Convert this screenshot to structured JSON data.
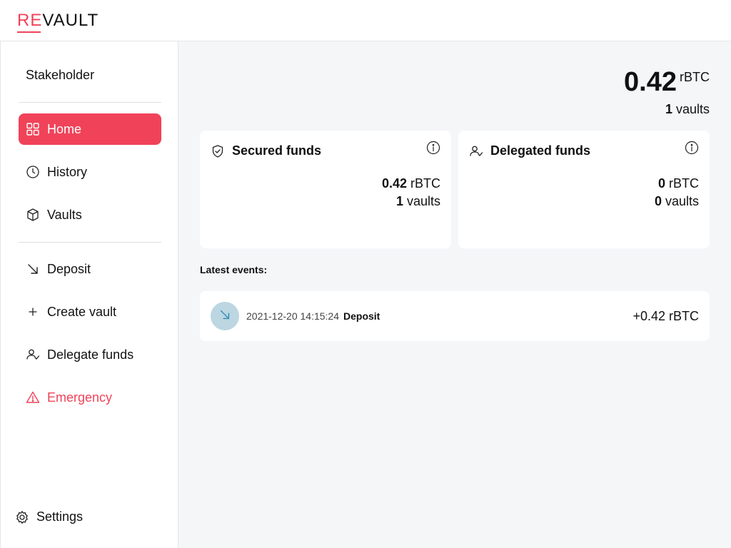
{
  "app": {
    "logo_re": "RE",
    "logo_vault": "VAULT",
    "accent_color": "#f04359"
  },
  "sidebar": {
    "role": "Stakeholder",
    "items": [
      {
        "label": "Home",
        "icon": "grid-icon",
        "active": true
      },
      {
        "label": "History",
        "icon": "clock-icon"
      },
      {
        "label": "Vaults",
        "icon": "box-icon"
      },
      {
        "label": "Deposit",
        "icon": "arrow-down-right-icon"
      },
      {
        "label": "Create vault",
        "icon": "plus-icon"
      },
      {
        "label": "Delegate funds",
        "icon": "person-check-icon"
      },
      {
        "label": "Emergency",
        "icon": "warning-icon"
      }
    ],
    "settings_label": "Settings"
  },
  "summary": {
    "amount": "0.42",
    "unit": "rBTC",
    "vaults_count": "1",
    "vaults_label": "vaults"
  },
  "cards": [
    {
      "title": "Secured funds",
      "icon": "shield-check-icon",
      "amount": "0.42",
      "unit": "rBTC",
      "vaults_count": "1",
      "vaults_label": "vaults"
    },
    {
      "title": "Delegated funds",
      "icon": "person-check-icon",
      "amount": "0",
      "unit": "rBTC",
      "vaults_count": "0",
      "vaults_label": "vaults"
    }
  ],
  "events": {
    "heading": "Latest events:",
    "items": [
      {
        "date": "2021-12-20 14:15:24",
        "type": "Deposit",
        "amount": "+0.42 rBTC",
        "icon": "arrow-down-right-icon"
      }
    ]
  }
}
